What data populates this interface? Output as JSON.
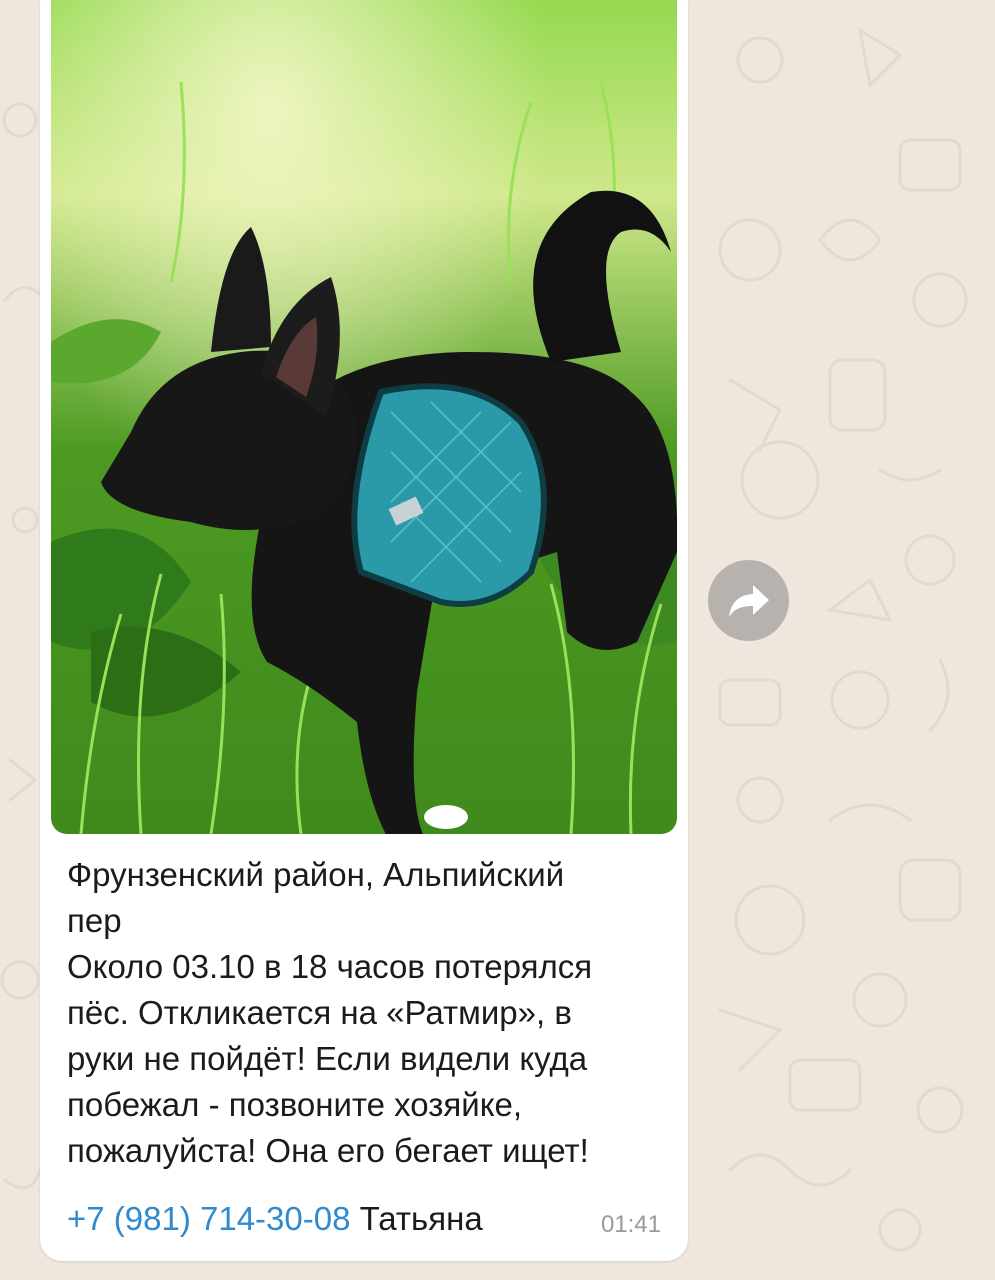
{
  "message": {
    "caption_lines": [
      "Фрунзенский район, Альпийский",
      "пер",
      "Около 03.10 в 18 часов потерялся",
      "пёс. Откликается на «Ратмир», в",
      "руки не пойдёт! Если видели куда",
      "побежал - позвоните хозяйке,",
      "пожалуйста! Она его бегает ищет!"
    ],
    "phone": "+7 (981) 714-30-08",
    "contact_name": "Татьяна",
    "time": "01:41"
  },
  "photo": {
    "subject": "black dog in teal harness on grass"
  },
  "colors": {
    "chat_background": "#efe7dd",
    "bubble": "#ffffff",
    "link": "#2f8ad0",
    "time": "#9a9a9a",
    "share_button": "#b7b2ad"
  },
  "icons": {
    "share": "forward-arrow-icon"
  }
}
